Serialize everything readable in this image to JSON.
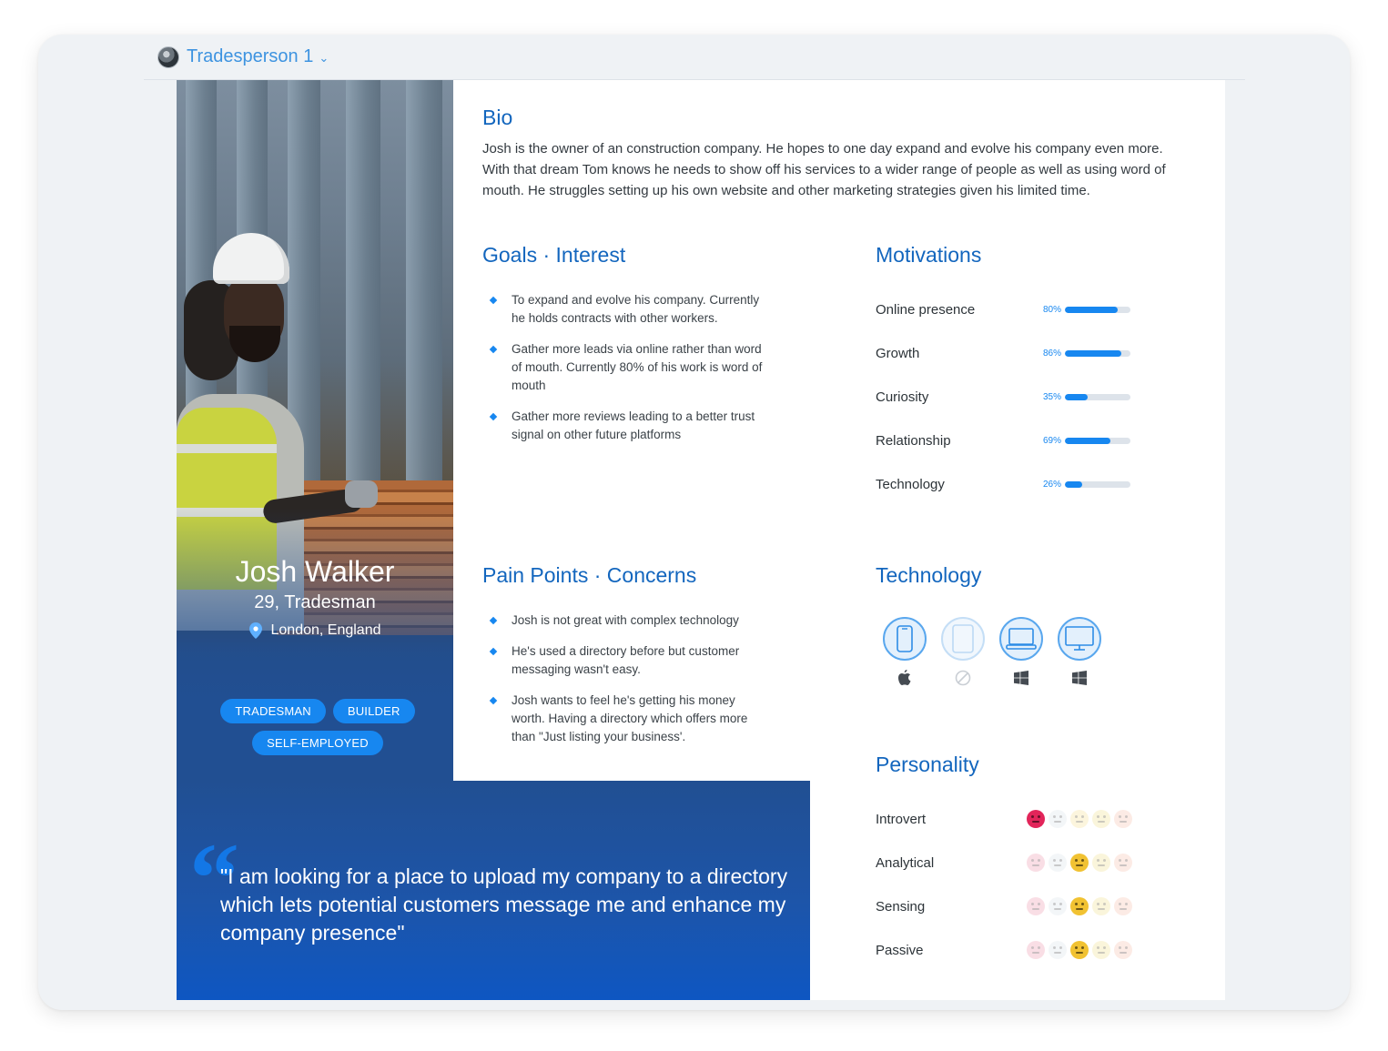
{
  "header": {
    "persona_selector": "Tradesperson 1"
  },
  "profile": {
    "name": "Josh Walker",
    "age_role": "29, Tradesman",
    "location": "London, England",
    "tags": [
      "TRADESMAN",
      "BUILDER",
      "SELF-EMPLOYED"
    ]
  },
  "quote": "\"I am looking for a place to upload my company to a directory which lets potential customers message me and enhance my company presence\"",
  "bio": {
    "heading": "Bio",
    "text": "Josh is the owner of an construction company. He hopes to one day expand and evolve his company even more. With that dream Tom knows he needs to show off his services to a wider range of people as well as using word of mouth. He struggles setting up his own website and other marketing strategies given his limited time."
  },
  "goals": {
    "heading": "Goals · Interest",
    "items": [
      "To expand and evolve his company. Currently he holds contracts with other workers.",
      "Gather more leads via online rather than word of mouth. Currently 80% of his work is word of mouth",
      "Gather more reviews leading to a better trust signal on other future platforms"
    ]
  },
  "pain_points": {
    "heading": "Pain Points · Concerns",
    "items": [
      "Josh is not great with complex technology",
      "He's used a directory before but customer messaging wasn't easy.",
      "Josh wants to feel he's getting his money worth. Having a directory which offers more than \"Just listing your business'."
    ]
  },
  "motivations": {
    "heading": "Motivations",
    "items": [
      {
        "label": "Online presence",
        "pct_label": "80%",
        "value": 80
      },
      {
        "label": "Growth",
        "pct_label": "86%",
        "value": 86
      },
      {
        "label": "Curiosity",
        "pct_label": "35%",
        "value": 35
      },
      {
        "label": "Relationship",
        "pct_label": "69%",
        "value": 69
      },
      {
        "label": "Technology",
        "pct_label": "26%",
        "value": 26
      }
    ]
  },
  "technology": {
    "heading": "Technology",
    "devices": [
      {
        "device": "phone-icon",
        "os": "apple-icon",
        "active": true
      },
      {
        "device": "tablet-icon",
        "os": "none-icon",
        "active": false
      },
      {
        "device": "laptop-icon",
        "os": "windows-icon",
        "active": true
      },
      {
        "device": "desktop-icon",
        "os": "windows-icon",
        "active": true
      }
    ]
  },
  "personality": {
    "heading": "Personality",
    "items": [
      {
        "label": "Introvert",
        "selected_index": 0
      },
      {
        "label": "Analytical",
        "selected_index": 2
      },
      {
        "label": "Sensing",
        "selected_index": 2
      },
      {
        "label": "Passive",
        "selected_index": 2
      }
    ]
  },
  "colors": {
    "accent": "#1787f0",
    "heading": "#1366be",
    "navy": "#214f92"
  }
}
